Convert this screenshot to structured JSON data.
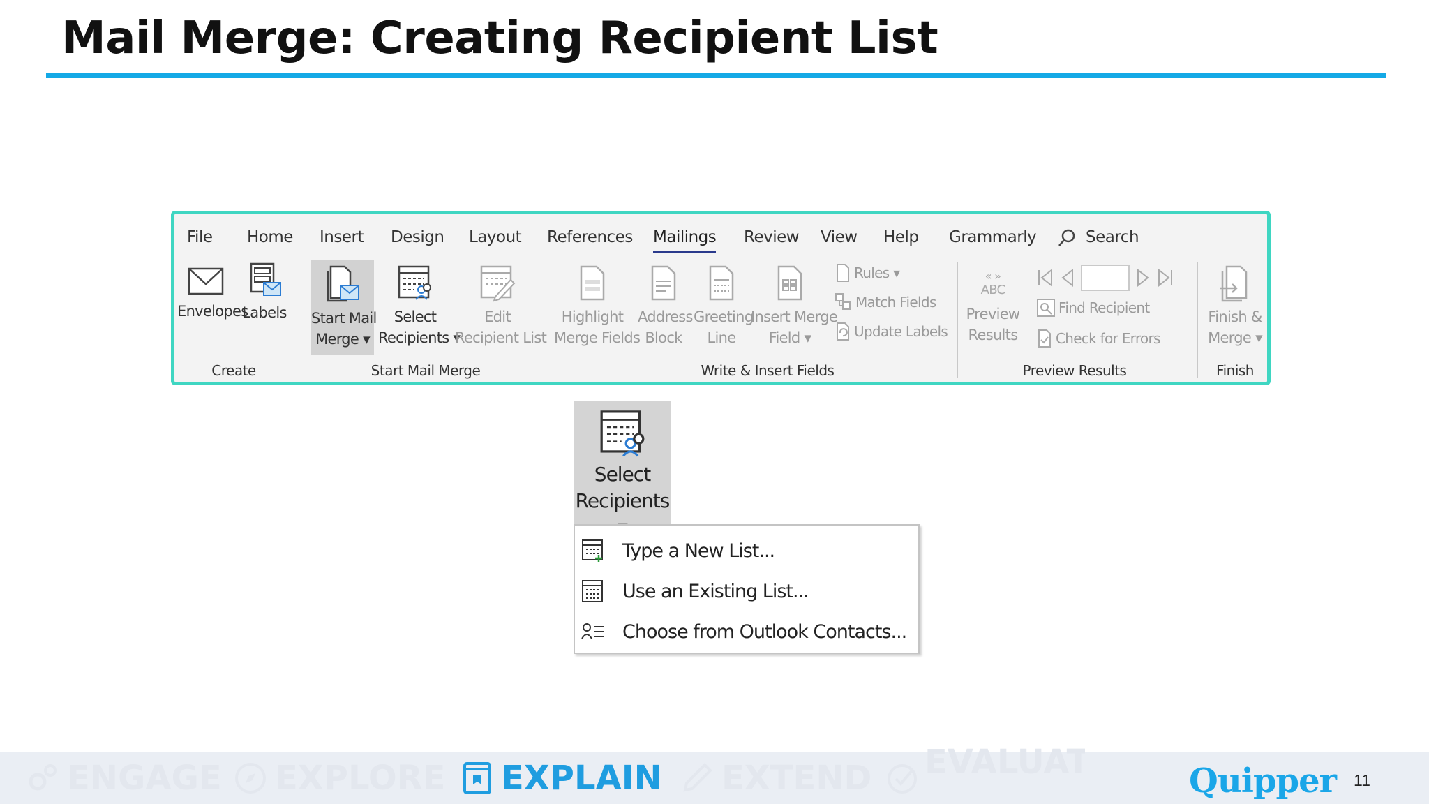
{
  "slide": {
    "title": "Mail Merge: Creating Recipient List",
    "page_number": "11"
  },
  "ribbon": {
    "tabs": [
      "File",
      "Home",
      "Insert",
      "Design",
      "Layout",
      "References",
      "Mailings",
      "Review",
      "View",
      "Help",
      "Grammarly"
    ],
    "active_tab": "Mailings",
    "search_label": "Search",
    "groups": {
      "create": {
        "label": "Create",
        "envelopes": "Envelopes",
        "labels": "Labels"
      },
      "start_mail_merge": {
        "label": "Start Mail Merge",
        "start_line1": "Start Mail",
        "start_line2": "Merge ▾",
        "select_line1": "Select",
        "select_line2": "Recipients ▾",
        "edit_line1": "Edit",
        "edit_line2": "Recipient List"
      },
      "write_insert": {
        "label": "Write & Insert Fields",
        "highlight_line1": "Highlight",
        "highlight_line2": "Merge Fields",
        "address_line1": "Address",
        "address_line2": "Block",
        "greeting_line1": "Greeting",
        "greeting_line2": "Line",
        "insert_line1": "Insert Merge",
        "insert_line2": "Field ▾",
        "rules": "Rules ▾",
        "match_fields": "Match Fields",
        "update_labels": "Update Labels"
      },
      "preview": {
        "label": "Preview Results",
        "abc": "ABC",
        "preview_line1": "Preview",
        "preview_line2": "Results",
        "find_recipient": "Find Recipient",
        "check_errors": "Check for Errors"
      },
      "finish": {
        "label": "Finish",
        "finish_line1": "Finish &",
        "finish_line2": "Merge ▾"
      }
    }
  },
  "zoom": {
    "line1": "Select",
    "line2": "Recipients ▾"
  },
  "menu": {
    "items": [
      "Type a New List...",
      "Use an Existing List...",
      "Choose from Outlook Contacts..."
    ]
  },
  "footer": {
    "phases": [
      "ENGAGE",
      "EXPLORE",
      "EXPLAIN",
      "EXTEND",
      "EVALUATE"
    ],
    "active_phase": "EXPLAIN",
    "brand": "Quipper"
  },
  "colors": {
    "title_rule": "#14a9e6",
    "ribbon_border": "#3fd6c2",
    "active_phase": "#1f9de0",
    "brand": "#1aa6e8"
  }
}
